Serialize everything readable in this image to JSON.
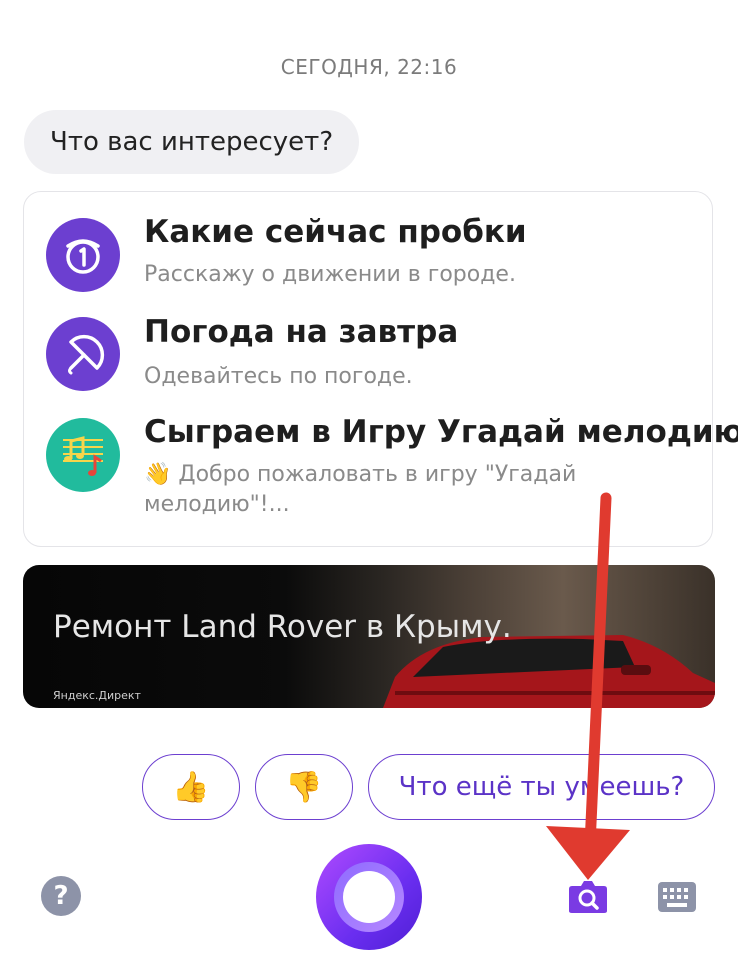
{
  "header": {
    "timestamp": "СЕГОДНЯ, 22:16"
  },
  "chat": {
    "question": "Что вас интересует?"
  },
  "suggestions": [
    {
      "title": "Какие сейчас пробки",
      "description": "Расскажу о движении в городе.",
      "icon": "traffic-clock-icon"
    },
    {
      "title": "Погода на завтра",
      "description": "Одевайтесь по погоде.",
      "icon": "umbrella-icon"
    },
    {
      "title": "Сыграем в Игру Угадай мелодию",
      "description": "👋 Добро пожаловать в игру \"Угадай мелодию\"!...",
      "icon": "music-notes-icon"
    }
  ],
  "ad": {
    "title": "Ремонт Land Rover в Крыму.",
    "source": "Яндекс.Директ"
  },
  "quick_replies": {
    "like": "👍",
    "dislike": "👎",
    "more": "Что ещё ты умеешь?"
  },
  "bottom_bar": {
    "help_icon": "question-icon",
    "mic_button": "alice-voice-button",
    "camera_search_icon": "camera-search-icon",
    "keyboard_icon": "keyboard-icon"
  },
  "colors": {
    "accent": "#6c3fd0",
    "teal": "#21bb9d",
    "annotation_arrow": "#e03a2f",
    "muted": "#8a8a8a"
  }
}
